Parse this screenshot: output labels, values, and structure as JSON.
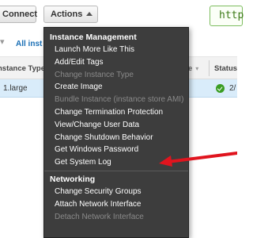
{
  "toolbar": {
    "connect_label": "Connect",
    "actions_label": "Actions",
    "green_box_text": "http"
  },
  "filter": {
    "prefix": "▾",
    "all_instances_label": "All inst"
  },
  "table": {
    "headers": {
      "instance_type": "nstance Type",
      "col_partial": "e",
      "status": "Status"
    },
    "row": {
      "instance_type": "1.large",
      "status_text": "2/"
    }
  },
  "menu": {
    "sections": [
      {
        "header": "Instance Management",
        "items": [
          {
            "label": "Launch More Like This",
            "enabled": true
          },
          {
            "label": "Add/Edit Tags",
            "enabled": true
          },
          {
            "label": "Change Instance Type",
            "enabled": false
          },
          {
            "label": "Create Image",
            "enabled": true
          },
          {
            "label": "Bundle Instance (instance store AMI)",
            "enabled": false
          },
          {
            "label": "Change Termination Protection",
            "enabled": true
          },
          {
            "label": "View/Change User Data",
            "enabled": true
          },
          {
            "label": "Change Shutdown Behavior",
            "enabled": true
          },
          {
            "label": "Get Windows Password",
            "enabled": true
          },
          {
            "label": "Get System Log",
            "enabled": true
          }
        ]
      },
      {
        "header": "Networking",
        "items": [
          {
            "label": "Change Security Groups",
            "enabled": true
          },
          {
            "label": "Attach Network Interface",
            "enabled": true
          },
          {
            "label": "Detach Network Interface",
            "enabled": false
          }
        ]
      }
    ]
  },
  "colors": {
    "menu_bg": "#3d3d3d",
    "menu_text": "#ffffff",
    "menu_disabled": "#8a8a8a",
    "arrow": "#e0141e",
    "selected_row": "#d9ecfa",
    "status_ok": "#3a9d23"
  }
}
